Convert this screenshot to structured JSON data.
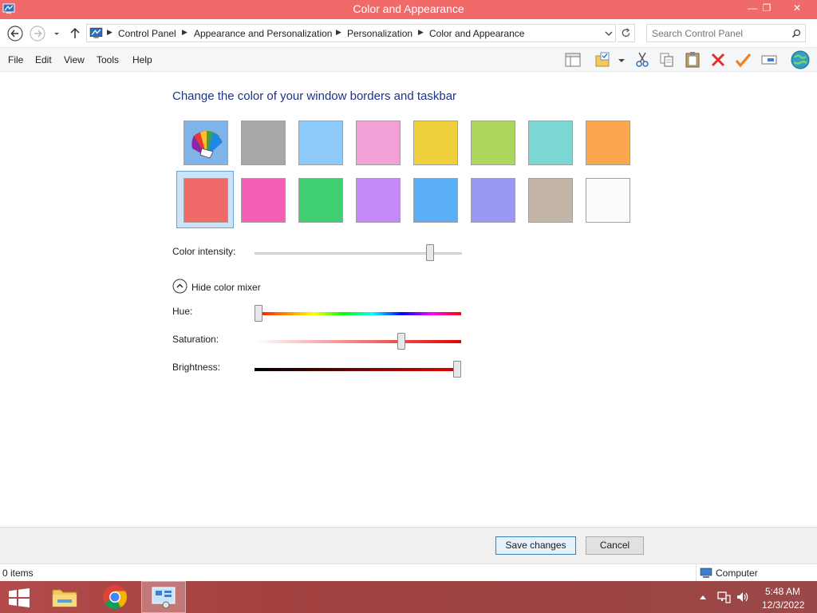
{
  "window": {
    "title": "Color and Appearance",
    "controls": {
      "minimize": "—",
      "restore": "❐",
      "close": "✕"
    }
  },
  "address": {
    "breadcrumbs": [
      "Control Panel",
      "Appearance and Personalization",
      "Personalization",
      "Color and Appearance"
    ],
    "search_placeholder": "Search Control Panel"
  },
  "menu": [
    "File",
    "Edit",
    "View",
    "Tools",
    "Help"
  ],
  "toolbar_icons": [
    "layout-pane-icon",
    "folder-check-icon",
    "dropdown-arrow-icon",
    "cut-icon",
    "copy-icon",
    "paste-icon",
    "delete-icon",
    "checkmark-icon",
    "rename-icon",
    "globe-icon"
  ],
  "main": {
    "heading": "Change the color of your window borders and taskbar",
    "swatches_row1": [
      {
        "name": "automatic",
        "color": "#7fb4ea"
      },
      {
        "name": "gray",
        "color": "#a8a8a8"
      },
      {
        "name": "sky",
        "color": "#8fcbfa"
      },
      {
        "name": "pink",
        "color": "#f2a0d6"
      },
      {
        "name": "yellow",
        "color": "#f0d03c"
      },
      {
        "name": "lime",
        "color": "#acd65e"
      },
      {
        "name": "teal",
        "color": "#7ad7d3"
      },
      {
        "name": "orange",
        "color": "#fca74d"
      }
    ],
    "swatches_row2": [
      {
        "name": "red",
        "color": "#f06a6a",
        "selected": true
      },
      {
        "name": "magenta",
        "color": "#f45eb3"
      },
      {
        "name": "green",
        "color": "#3ecf73"
      },
      {
        "name": "violet",
        "color": "#c58af7"
      },
      {
        "name": "blue",
        "color": "#5baff7"
      },
      {
        "name": "periwinkle",
        "color": "#9a98f5"
      },
      {
        "name": "taupe",
        "color": "#c2b5a8"
      },
      {
        "name": "white",
        "color": "#fbfbfb"
      }
    ],
    "color_intensity": {
      "label": "Color intensity:",
      "value": 0.86
    },
    "mixer_toggle": "Hide color mixer",
    "hue": {
      "label": "Hue:",
      "value": 0.0
    },
    "saturation": {
      "label": "Saturation:",
      "value": 0.72
    },
    "brightness": {
      "label": "Brightness:",
      "value": 1.0
    }
  },
  "buttons": {
    "save": "Save changes",
    "cancel": "Cancel"
  },
  "status": {
    "items": "0 items",
    "location": "Computer"
  },
  "taskbar": {
    "time": "5:48 AM",
    "date": "12/3/2022"
  },
  "colors": {
    "accent": "#f06a6a",
    "heading": "#1e3287"
  }
}
